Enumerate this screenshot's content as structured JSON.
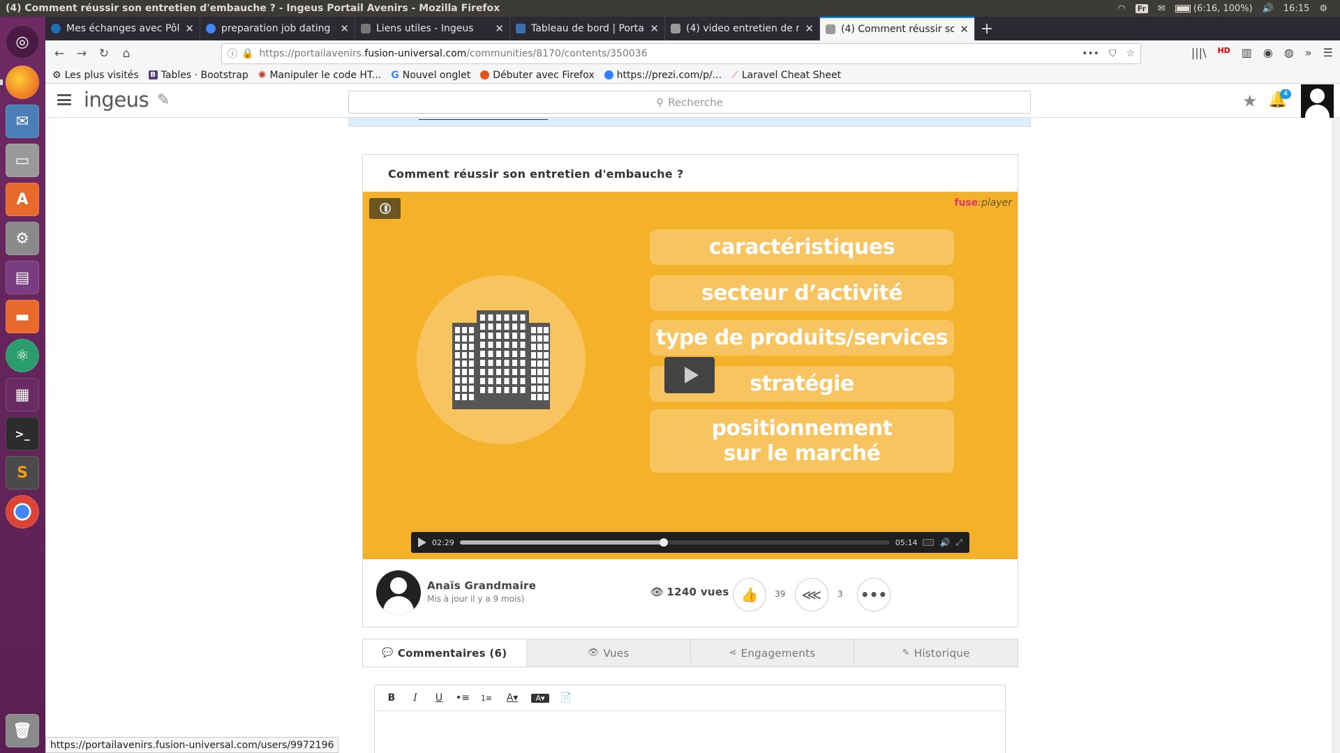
{
  "system": {
    "window_title": "(4) Comment réussir son entretien d'embauche ? - Ingeus Portail Avenirs - Mozilla Firefox",
    "keyboard_layout": "Fr",
    "battery": "(6:16, 100%)",
    "clock": "16:15"
  },
  "launcher": {
    "apps": [
      "ubuntu-dash-icon",
      "firefox-icon",
      "thunderbird-icon",
      "files-cabinet-icon",
      "software-center-icon",
      "system-settings-icon",
      "window-manager-icon",
      "file-manager-icon",
      "atom-icon",
      "workspace-icon",
      "terminal-icon",
      "sublime-text-icon",
      "chrome-icon",
      "trash-icon"
    ]
  },
  "browser": {
    "tabs": [
      {
        "title": "Mes échanges avec Pôle",
        "color": "#1f6fb5"
      },
      {
        "title": "preparation job dating -",
        "color": "#4285f4"
      },
      {
        "title": "Liens utiles - Ingeus",
        "color": "#777777"
      },
      {
        "title": "Tableau de bord | Portail",
        "color": "#3a6fb0"
      },
      {
        "title": "(4) video entretien de re",
        "color": "#999999"
      },
      {
        "title": "(4) Comment réussir son",
        "color": "#999999"
      }
    ],
    "url_prefix": "https://portailavenirs.",
    "url_host": "fusion-universal.com",
    "url_path": "/communities/8170/contents/350036",
    "bookmarks": [
      {
        "label": "Les plus visités",
        "icon": "gear-icon"
      },
      {
        "label": "Tables · Bootstrap",
        "icon": "bootstrap-icon"
      },
      {
        "label": "Manipuler le code HT...",
        "icon": "mdn-icon"
      },
      {
        "label": "Nouvel onglet",
        "icon": "google-icon"
      },
      {
        "label": "Débuter avec Firefox",
        "icon": "firefox-icon"
      },
      {
        "label": "https://prezi.com/p/...",
        "icon": "prezi-icon"
      },
      {
        "label": "Laravel Cheat Sheet",
        "icon": "laravel-icon"
      }
    ],
    "status_url": "https://portailavenirs.fusion-universal.com/users/9972196"
  },
  "app": {
    "brand": "ingeus",
    "search_placeholder": "Recherche",
    "notifications_count": "4"
  },
  "content": {
    "title": "Comment réussir son entretien d'embauche ?",
    "player_brand": "fuse",
    "player_brand_suffix": ":player",
    "slide_items": [
      "caractéristiques",
      "secteur d’activité",
      "type de produits/services",
      "stratégie",
      "positionnement\nsur le marché"
    ],
    "current_time": "02:29",
    "duration": "05:14",
    "progress_fraction": 0.474,
    "author_name": "Anaïs Grandmaire",
    "author_updated": "Mis à jour il y a 9 mois)",
    "views": "1240 vues",
    "likes": "39",
    "shares": "3"
  },
  "tabs": [
    {
      "label": "Commentaires (6)",
      "icon": "comment-icon"
    },
    {
      "label": "Vues",
      "icon": "eye-icon"
    },
    {
      "label": "Engagements",
      "icon": "share-icon"
    },
    {
      "label": "Historique",
      "icon": "pencil-icon"
    }
  ],
  "editor_toolbar": [
    "B",
    "I",
    "U",
    "•≡",
    "1≡",
    "A▾",
    "A▾",
    "📄"
  ],
  "colors": {
    "slide_background": "#f4b12a",
    "pill": "#f7c45f",
    "accent_blue": "#1e9bd7",
    "launcher": "#6e2a63"
  }
}
